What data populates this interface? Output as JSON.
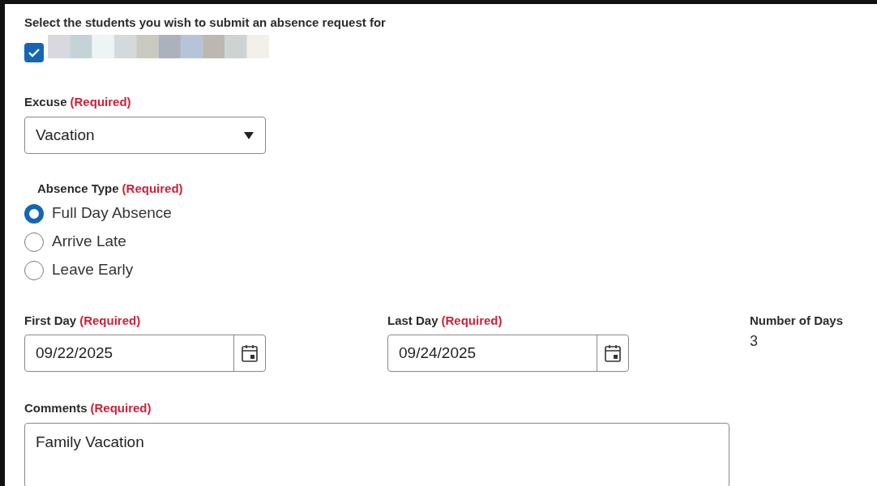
{
  "students": {
    "heading": "Select the students you wish to submit an absence request for",
    "items": [
      {
        "checked": true,
        "kind": "picture"
      }
    ]
  },
  "excuse": {
    "label": "Excuse",
    "required": "(Required)",
    "value": "Vacation"
  },
  "absence_type": {
    "label": "Absence Type",
    "required": "(Required)",
    "options": [
      {
        "label": "Full Day Absence",
        "selected": true
      },
      {
        "label": "Arrive Late",
        "selected": false
      },
      {
        "label": "Leave Early",
        "selected": false
      }
    ]
  },
  "first_day": {
    "label": "First Day",
    "required": "(Required)",
    "value": "09/22/2025"
  },
  "last_day": {
    "label": "Last Day",
    "required": "(Required)",
    "value": "09/24/2025"
  },
  "number_of_days": {
    "label": "Number of Days",
    "value": "3"
  },
  "comments": {
    "label": "Comments",
    "required": "(Required)",
    "value": "Family Vacation"
  }
}
